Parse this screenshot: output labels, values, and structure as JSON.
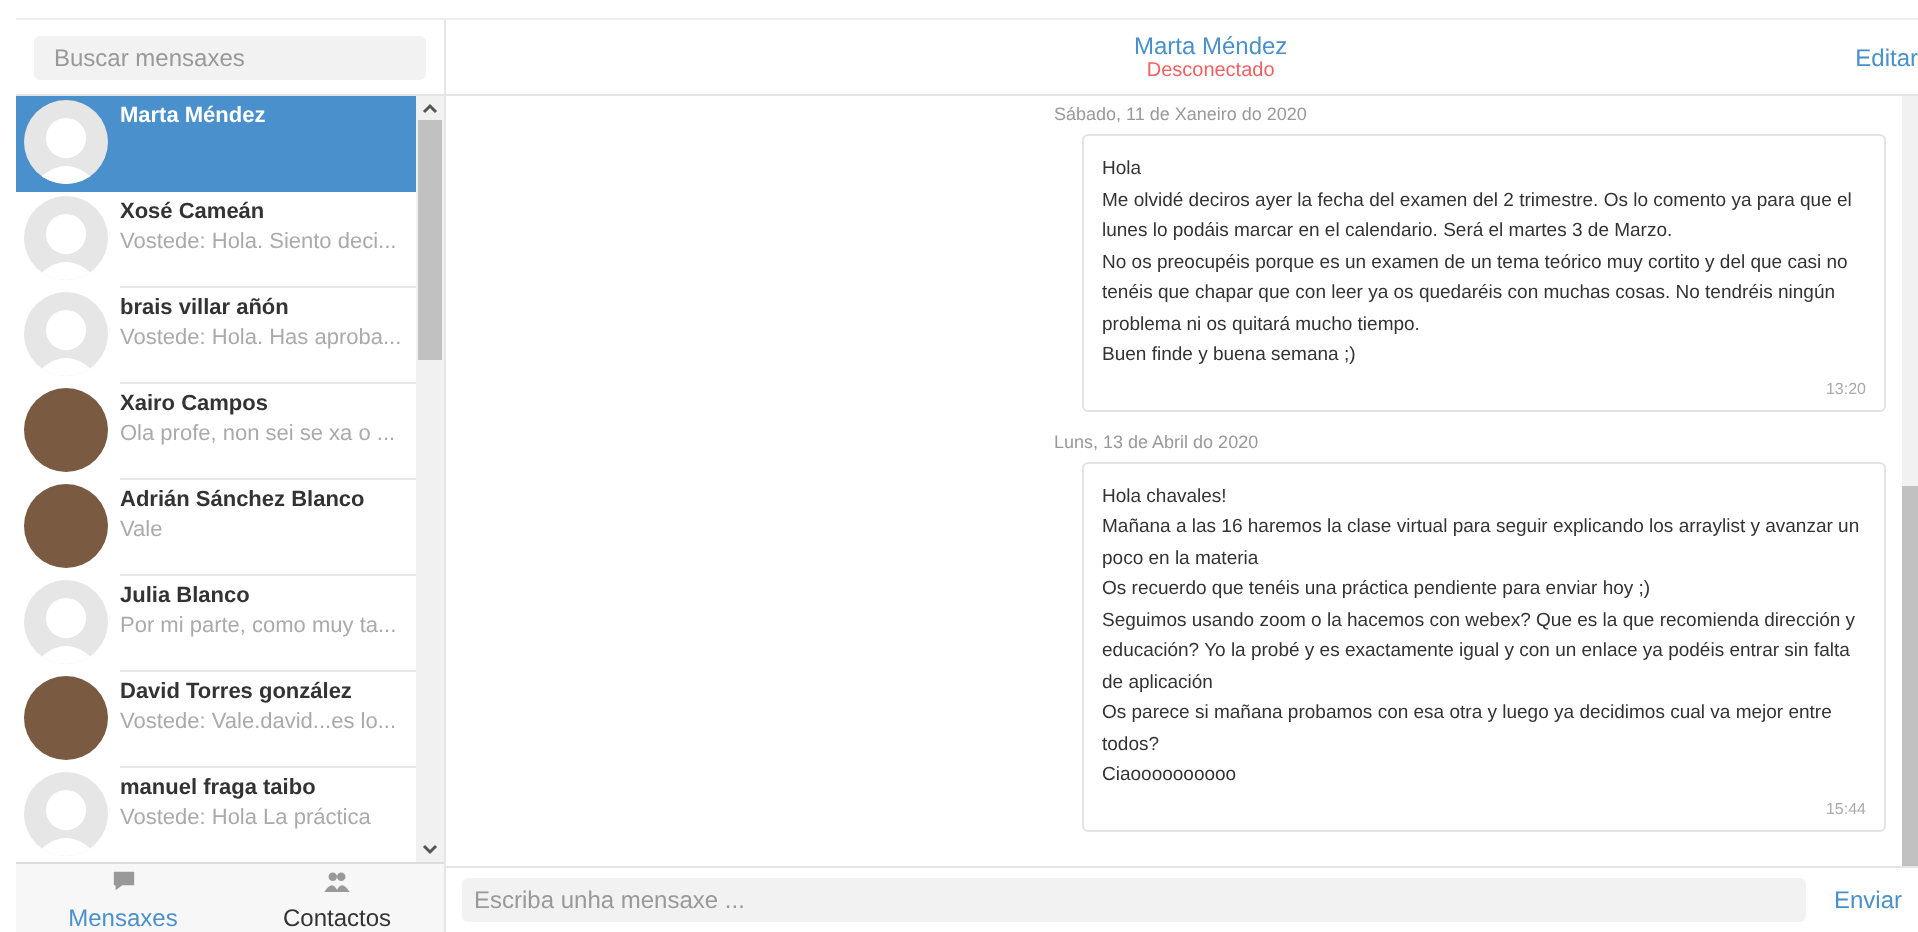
{
  "sidebar": {
    "search": {
      "placeholder": "Buscar mensaxes"
    },
    "contacts": [
      {
        "name": "Marta Méndez",
        "photo": false,
        "selected": true
      },
      {
        "name": "Xosé Cameán",
        "preview": "Vostede: Hola. Siento deci...",
        "photo": false,
        "selected": false
      },
      {
        "name": "brais villar añón",
        "preview": "Vostede: Hola. Has aproba...",
        "photo": false,
        "selected": false
      },
      {
        "name": "Xairo Campos",
        "preview": "Ola profe, non sei se xa o ...",
        "photo": true,
        "selected": false
      },
      {
        "name": "Adrián Sánchez Blanco",
        "preview": "Vale",
        "photo": true,
        "selected": false
      },
      {
        "name": "Julia Blanco",
        "preview": "Por mi parte, como muy ta...",
        "photo": false,
        "selected": false
      },
      {
        "name": "David Torres gonzález",
        "preview": "Vostede: Vale.david...es lo...",
        "photo": true,
        "selected": false
      },
      {
        "name": "manuel fraga taibo",
        "preview": "Vostede: Hola La práctica",
        "photo": false,
        "selected": false
      }
    ],
    "tabs": [
      {
        "label": "Mensaxes",
        "selected": true
      },
      {
        "label": "Contactos",
        "selected": false
      }
    ]
  },
  "chat": {
    "contact": "Marta Méndez",
    "status": "Desconectado",
    "online": false,
    "edit": "Editar",
    "days": [
      {
        "date": "Sábado, 11 de Xaneiro do 2020",
        "messages": [
          {
            "lines": [
              "Hola",
              "Me olvidé deciros ayer la fecha del examen del 2 trimestre. Os lo comento ya para que el lunes lo podáis marcar en el calendario. Será el martes 3 de Marzo.",
              "No os preocupéis porque es un examen de un tema teórico muy cortito y del que casi no tenéis que chapar que con leer ya os quedaréis con muchas cosas. No tendréis ningún problema ni os quitará mucho tiempo.",
              "Buen finde y buena semana ;)"
            ],
            "time": "13:20"
          }
        ]
      },
      {
        "date": "Luns, 13 de Abril do 2020",
        "messages": [
          {
            "lines": [
              "Hola chavales!",
              "Mañana a las 16 haremos la clase virtual para seguir explicando los arraylist y avanzar un poco en la materia",
              "Os recuerdo que tenéis una práctica pendiente para enviar hoy ;)",
              "Seguimos usando zoom o la hacemos con webex? Que es la que recomienda dirección y educación? Yo la probé y es exactamente igual y con un enlace ya podéis entrar sin falta de aplicación",
              "Os parece si mañana probamos con esa otra y luego ya decidimos cual va mejor entre todos?",
              "Ciaoooooooooo"
            ],
            "time": "15:44"
          }
        ]
      }
    ],
    "composer": {
      "placeholder": "Escriba unha mensaxe ...",
      "send": "Enviar"
    }
  }
}
